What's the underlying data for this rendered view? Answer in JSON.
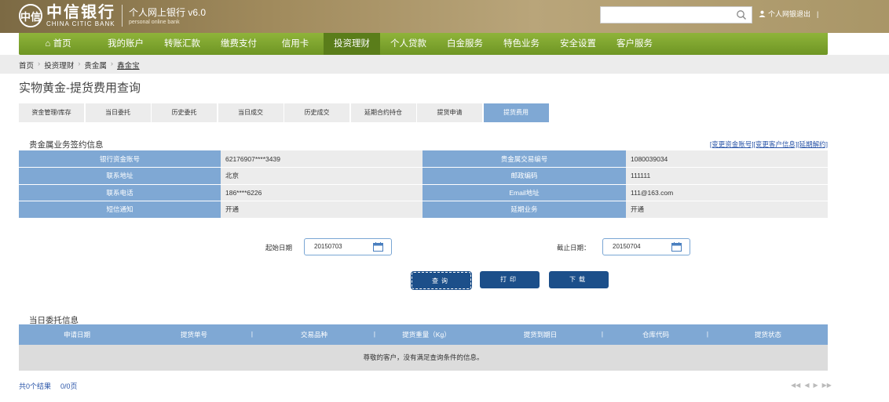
{
  "header": {
    "logo_symbol": "中信",
    "bank_name_cn": "中信银行",
    "bank_name_en": "CHINA CITIC BANK",
    "product_cn": "个人网上银行 v6.0",
    "product_en": "personal online bank",
    "search_placeholder": "",
    "user_text": "个人网银退出"
  },
  "nav": {
    "items": [
      {
        "label": "⌂ 首页"
      },
      {
        "label": "我的账户"
      },
      {
        "label": "转账汇款"
      },
      {
        "label": "缴费支付"
      },
      {
        "label": "信用卡"
      },
      {
        "label": "投资理财"
      },
      {
        "label": "个人贷款"
      },
      {
        "label": "白金服务"
      },
      {
        "label": "特色业务"
      },
      {
        "label": "安全设置"
      },
      {
        "label": "客户服务"
      }
    ],
    "active_index": 5
  },
  "breadcrumb": [
    "首页",
    "投资理财",
    "贵金属",
    "鑫金宝"
  ],
  "page_title": "实物黄金-提货费用查询",
  "tabs": [
    "资金管理/库存",
    "当日委托",
    "历史委托",
    "当日成交",
    "历史成交",
    "延期合约持仓",
    "提货申请",
    "提货费用"
  ],
  "active_tab": 7,
  "info_section": {
    "title": "贵金属业务签约信息",
    "links": "[变更资金账号][变更客户信息][延期解约]",
    "rows": [
      {
        "l1": "银行资金账号",
        "v1": "62176907****3439",
        "l2": "贵金属交易编号",
        "v2": "1080039034"
      },
      {
        "l1": "联系地址",
        "v1": "北京",
        "l2": "邮政编码",
        "v2": "111111"
      },
      {
        "l1": "联系电话",
        "v1": "186****6226",
        "l2": "Email地址",
        "v2": "111@163.com"
      },
      {
        "l1": "短信通知",
        "v1": "开通",
        "l2": "延期业务",
        "v2": "开通"
      }
    ]
  },
  "dates": {
    "start_label": "起始日期",
    "start_value": "20150703",
    "end_label": "截止日期：",
    "end_value": "20150704"
  },
  "buttons": {
    "query": "查询",
    "print": "打印",
    "download": "下载"
  },
  "results": {
    "title": "当日委托信息",
    "columns": [
      "申请日期",
      "提货单号",
      "交易品种",
      "提货重量（Kg）",
      "提货到期日",
      "仓库代码",
      "提货状态"
    ],
    "empty_message": "尊敬的客户，没有满足查询条件的信息。"
  },
  "footer": {
    "count": "共0个结果",
    "pages": "0/0页"
  },
  "colors": {
    "nav_green": "#7ea830",
    "label_blue": "#7fa8d4",
    "button_navy": "#1c4f8a",
    "link_blue": "#2a55a8"
  }
}
